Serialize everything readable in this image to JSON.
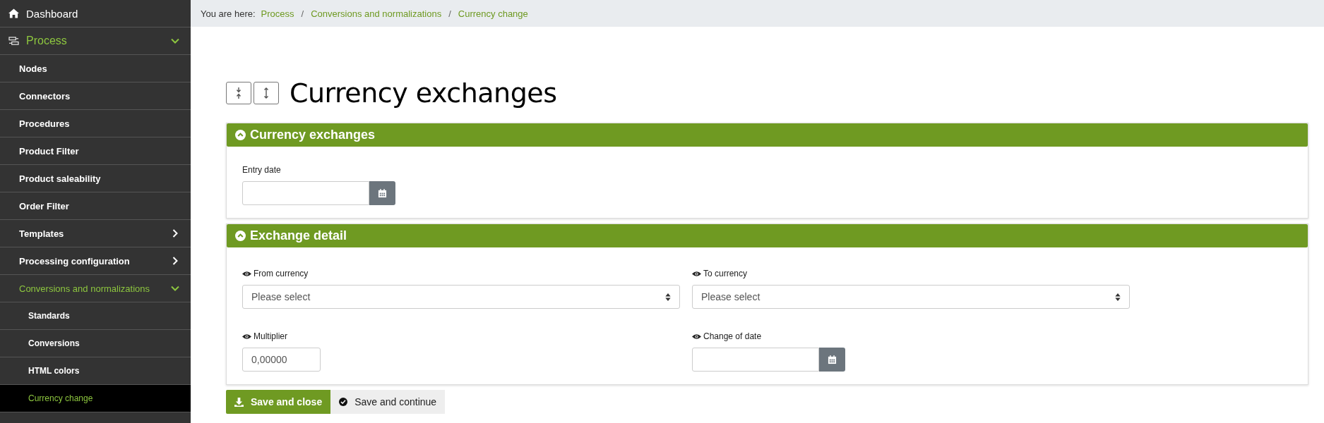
{
  "sidebar": {
    "items": [
      {
        "label": "Dashboard",
        "selected": false
      },
      {
        "label": "Process",
        "selected": false,
        "expanded": true,
        "children": [
          {
            "label": "Nodes",
            "selected": false
          },
          {
            "label": "Connectors",
            "selected": false
          },
          {
            "label": "Procedures",
            "selected": false
          },
          {
            "label": "Product Filter",
            "selected": false
          },
          {
            "label": "Product saleability",
            "selected": false
          },
          {
            "label": "Order Filter",
            "selected": false
          },
          {
            "label": "Templates",
            "selected": false,
            "expanded": false
          },
          {
            "label": "Processing configuration",
            "selected": false,
            "expanded": false
          },
          {
            "label": "Conversions and normalizations",
            "selected": false,
            "expanded": true,
            "children": [
              {
                "label": "Standards",
                "selected": false
              },
              {
                "label": "Conversions",
                "selected": false
              },
              {
                "label": "HTML colors",
                "selected": false
              },
              {
                "label": "Currency change",
                "selected": true
              }
            ]
          }
        ]
      }
    ]
  },
  "breadcrumb": {
    "prefix": "You are here:",
    "items": [
      "Process",
      "Conversions and normalizations",
      "Currency change"
    ],
    "separator": "/"
  },
  "page_title": "Currency exchanges",
  "sections": [
    {
      "title": "Currency exchanges",
      "expanded": true,
      "fields": [
        {
          "kind": "date",
          "label": "Entry date",
          "eye_marker": false
        }
      ]
    },
    {
      "title": "Exchange detail",
      "expanded": true,
      "fields": [
        {
          "kind": "select",
          "label": "From currency",
          "eye_marker": true,
          "value": "Please select"
        },
        {
          "kind": "select",
          "label": "To currency",
          "eye_marker": true,
          "value": "Please select"
        },
        {
          "kind": "number",
          "label": "Multiplier",
          "eye_marker": true,
          "value": "0,00000"
        },
        {
          "kind": "date",
          "label": "Change of date",
          "eye_marker": true
        }
      ]
    }
  ],
  "buttons": [
    {
      "kind": "primary",
      "label": "Save and close"
    },
    {
      "kind": "secondary",
      "label": "Save and continue"
    }
  ]
}
